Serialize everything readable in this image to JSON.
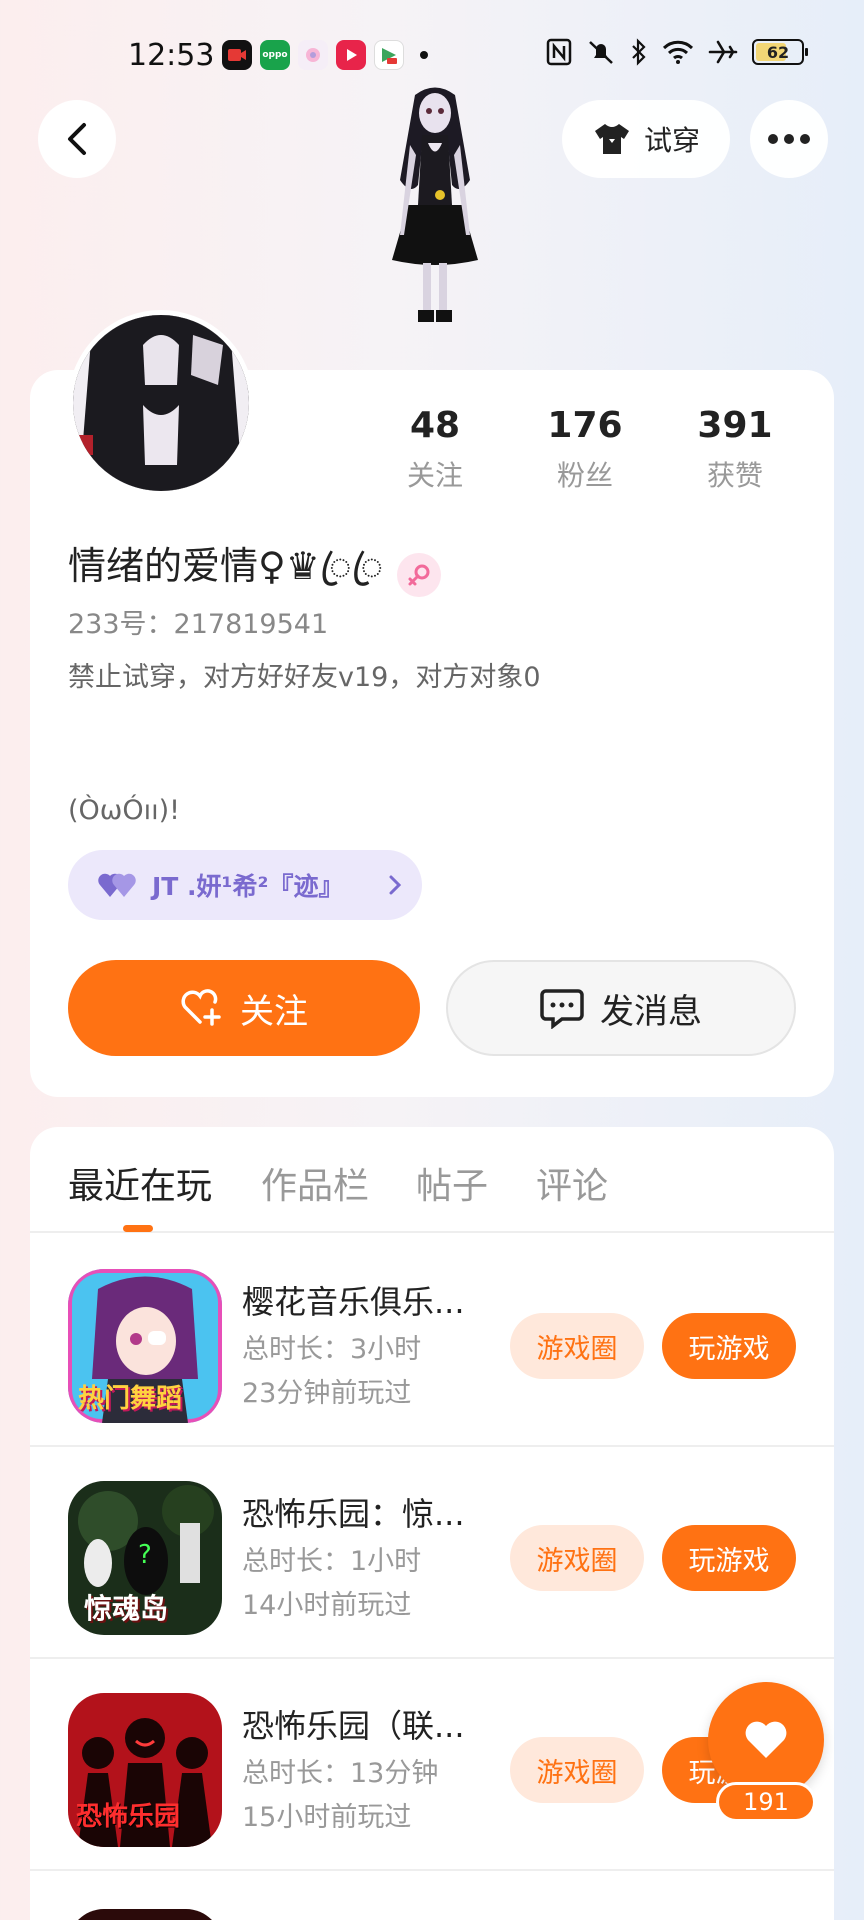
{
  "status_bar": {
    "time": "12:53",
    "battery": "62",
    "apps": [
      {
        "name": "video-call-app-icon",
        "color": "#d81e06"
      },
      {
        "name": "oppo-app-icon",
        "color": "#19a34b",
        "label": "oppo"
      },
      {
        "name": "flower-app-icon",
        "color": "#f3e5f5"
      },
      {
        "name": "video-player-app-icon",
        "color": "#e8244a"
      },
      {
        "name": "game-center-app-icon",
        "color": "#6a3fd1"
      }
    ]
  },
  "header": {
    "tryon_label": "试穿"
  },
  "profile": {
    "stats": [
      {
        "value": "48",
        "label": "关注"
      },
      {
        "value": "176",
        "label": "粉丝"
      },
      {
        "value": "391",
        "label": "获赞"
      }
    ],
    "nickname": "情绪的爱情♀♛ꦿꦿ",
    "uid": "233号：217819541",
    "bio": "禁止试穿，对方好好友v19，对方对象0",
    "bio_line2": "(ÒωÓıı)!",
    "cp_name": "JT .妍¹希²『迹』",
    "follow_label": "关注",
    "message_label": "发消息"
  },
  "tabs": [
    {
      "label": "最近在玩",
      "active": true
    },
    {
      "label": "作品栏",
      "active": false
    },
    {
      "label": "帖子",
      "active": false
    },
    {
      "label": "评论",
      "active": false
    }
  ],
  "games": [
    {
      "title": "樱花音乐俱乐...",
      "duration": "总时长：3小时",
      "recent": "23分钟前玩过",
      "circle_label": "游戏圈",
      "play_label": "玩游戏"
    },
    {
      "title": "恐怖乐园：惊...",
      "duration": "总时长：1小时",
      "recent": "14小时前玩过",
      "circle_label": "游戏圈",
      "play_label": "玩游戏"
    },
    {
      "title": "恐怖乐园（联...",
      "duration": "总时长：13分钟",
      "recent": "15小时前玩过",
      "circle_label": "游戏圈",
      "play_label": "玩游戏"
    }
  ],
  "game_icon_texts": [
    "热门舞蹈",
    "惊魂岛",
    "恐怖乐园"
  ],
  "like_fab": {
    "count": "191"
  },
  "colors": {
    "accent": "#ff7213",
    "accent_light": "#ffe8db",
    "cp_pill_bg": "#ece8fb",
    "cp_text": "#7a6acf"
  }
}
